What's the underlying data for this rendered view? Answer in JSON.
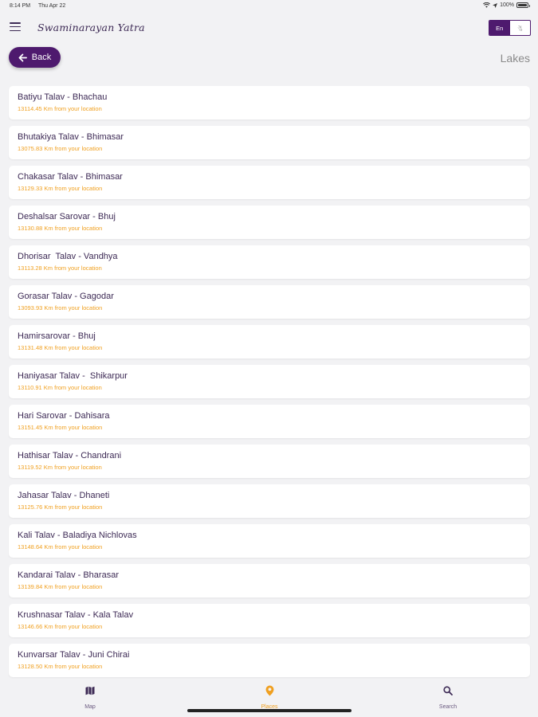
{
  "status_bar": {
    "time": "8:14 PM",
    "date": "Thu Apr 22",
    "battery": "100%"
  },
  "header": {
    "title": "Swaminarayan Yatra",
    "lang_active": "En",
    "lang_other": "ગુ"
  },
  "toolbar": {
    "back_label": "Back",
    "page_title": "Lakes"
  },
  "places": [
    {
      "name": "Batiyu Talav - Bhachau",
      "distance": "13114.45 Km from your location"
    },
    {
      "name": "Bhutakiya Talav - Bhimasar",
      "distance": "13075.83 Km from your location"
    },
    {
      "name": "Chakasar Talav - Bhimasar",
      "distance": "13129.33 Km from your location"
    },
    {
      "name": "Deshalsar Sarovar - Bhuj",
      "distance": "13130.88 Km from your location"
    },
    {
      "name": "Dhorisar  Talav - Vandhya",
      "distance": "13113.28 Km from your location"
    },
    {
      "name": "Gorasar Talav - Gagodar",
      "distance": "13093.93 Km from your location"
    },
    {
      "name": "Hamirsarovar - Bhuj",
      "distance": "13131.48 Km from your location"
    },
    {
      "name": "Haniyasar Talav -  Shikarpur",
      "distance": "13110.91 Km from your location"
    },
    {
      "name": "Hari Sarovar - Dahisara",
      "distance": "13151.45 Km from your location"
    },
    {
      "name": "Hathisar Talav - Chandrani",
      "distance": "13119.52 Km from your location"
    },
    {
      "name": "Jahasar Talav - Dhaneti",
      "distance": "13125.76 Km from your location"
    },
    {
      "name": "Kali Talav - Baladiya Nichlovas",
      "distance": "13148.64 Km from your location"
    },
    {
      "name": "Kandarai Talav - Bharasar",
      "distance": "13139.84 Km from your location"
    },
    {
      "name": "Krushnasar Talav - Kala Talav",
      "distance": "13146.66 Km from your location"
    },
    {
      "name": "Kunvarsar Talav - Juni Chirai",
      "distance": "13128.50 Km from your location"
    }
  ],
  "tabs": [
    {
      "label": "Map",
      "icon": "map-icon"
    },
    {
      "label": "Places",
      "icon": "location-pin-icon",
      "active": true
    },
    {
      "label": "Search",
      "icon": "search-icon"
    }
  ],
  "colors": {
    "primary": "#4e1a6e",
    "accent": "#f0a020",
    "background": "#f2f2f4"
  }
}
